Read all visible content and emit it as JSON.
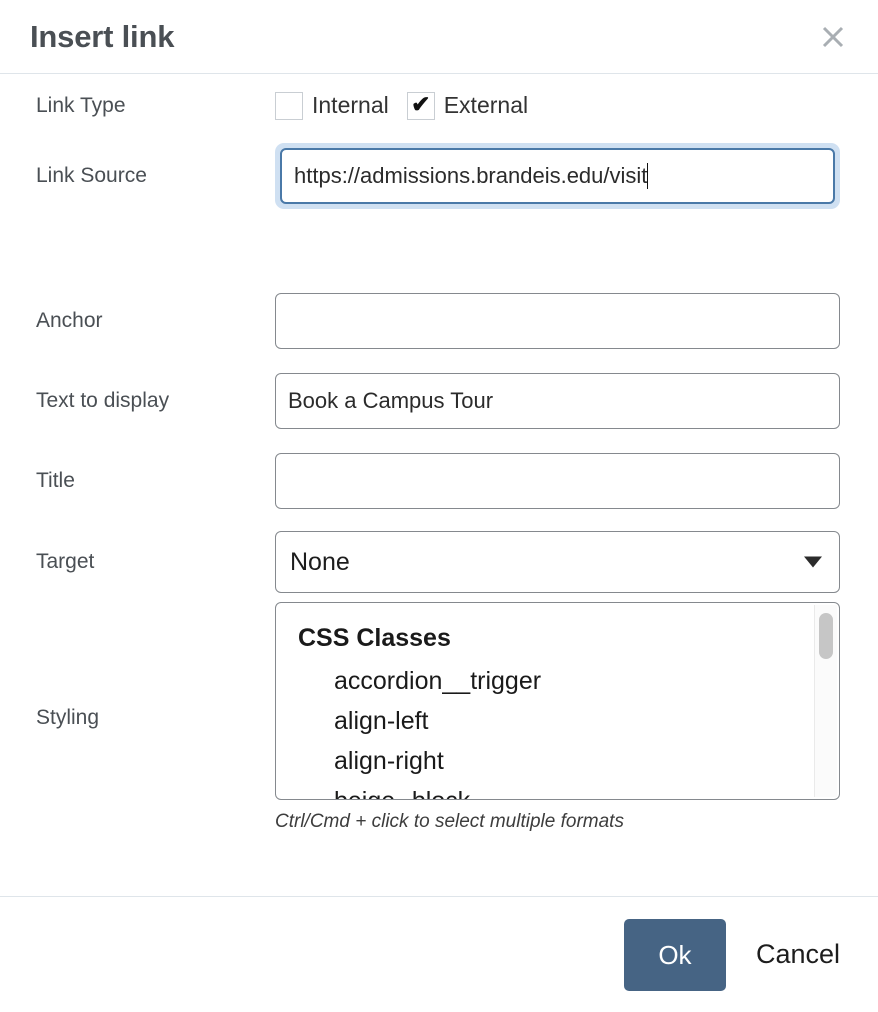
{
  "dialog": {
    "title": "Insert link",
    "close_icon": "close-icon"
  },
  "form": {
    "link_type": {
      "label": "Link Type",
      "options": [
        {
          "label": "Internal",
          "checked": false
        },
        {
          "label": "External",
          "checked": true
        }
      ]
    },
    "link_source": {
      "label": "Link Source",
      "value": "https://admissions.brandeis.edu/visit",
      "placeholder": "",
      "focused": true
    },
    "anchor": {
      "label": "Anchor",
      "value": "",
      "placeholder": ""
    },
    "text_to_display": {
      "label": "Text to display",
      "value": "Book a Campus Tour",
      "placeholder": ""
    },
    "title_field": {
      "label": "Title",
      "value": "",
      "placeholder": ""
    },
    "target": {
      "label": "Target",
      "selected": "None",
      "options": [
        "None"
      ],
      "arrow_icon": "chevron-down-icon"
    },
    "styling": {
      "label": "Styling",
      "group_label": "CSS Classes",
      "options": [
        "accordion__trigger",
        "align-left",
        "align-right",
        "beige--block"
      ],
      "help_text": "Ctrl/Cmd + click to select multiple formats"
    }
  },
  "footer": {
    "ok_label": "Ok",
    "cancel_label": "Cancel"
  },
  "colors": {
    "primary_button": "#466484",
    "focus_border": "#4a79a8",
    "focus_glow": "#cfe0f2",
    "input_border": "#85898e",
    "divider": "#dfe5ea",
    "label_text": "#4a4f54"
  }
}
